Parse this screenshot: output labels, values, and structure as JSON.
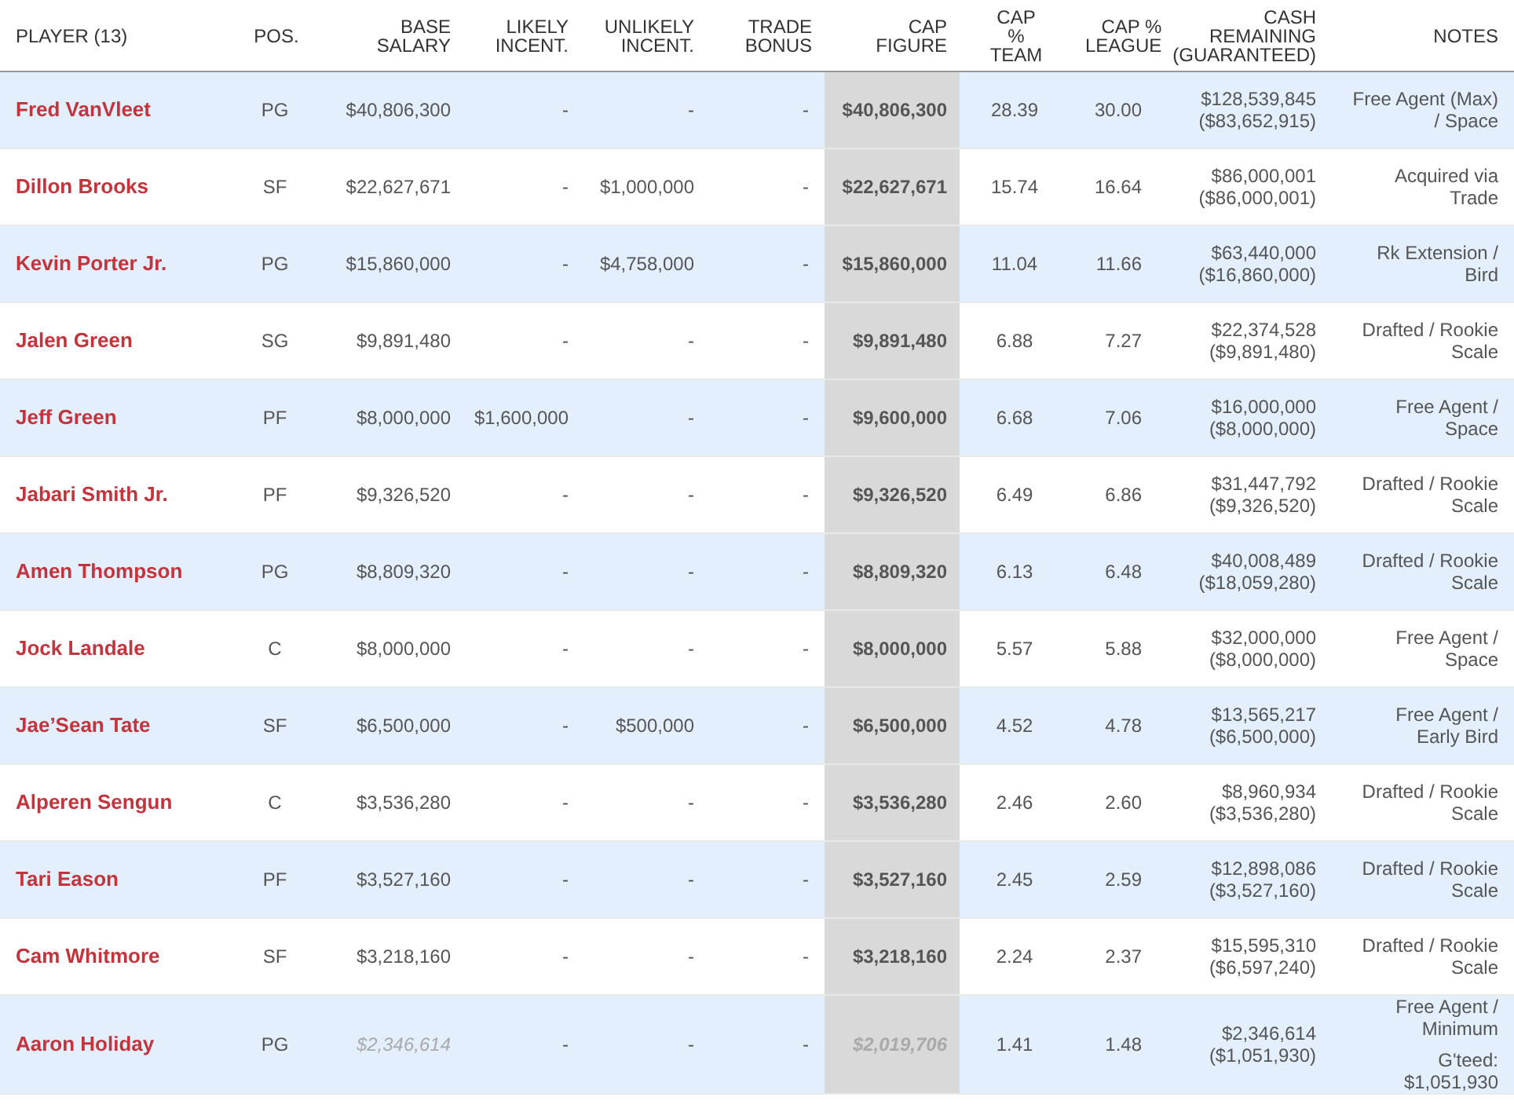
{
  "table": {
    "columns": [
      "PLAYER (13)",
      "POS.",
      "BASE\nSALARY",
      "LIKELY\nINCENT.",
      "UNLIKELY\nINCENT.",
      "TRADE\nBONUS",
      "CAP\nFIGURE",
      "CAP\n%\nTEAM",
      "CAP %\nLEAGUE",
      "CASH\nREMAINING\n(GUARANTEED)",
      "NOTES"
    ],
    "rows": [
      {
        "player": "Fred VanVleet",
        "pos": "PG",
        "base": "$40,806,300",
        "likely": "-",
        "unlikely": "-",
        "trade": "-",
        "cap": "$40,806,300",
        "team_pct": "28.39",
        "league_pct": "30.00",
        "cash": "$128,539,845",
        "guaranteed": "($83,652,915)",
        "notes": [
          "Free Agent (Max) / Space"
        ],
        "non_guaranteed": false
      },
      {
        "player": "Dillon Brooks",
        "pos": "SF",
        "base": "$22,627,671",
        "likely": "-",
        "unlikely": "$1,000,000",
        "trade": "-",
        "cap": "$22,627,671",
        "team_pct": "15.74",
        "league_pct": "16.64",
        "cash": "$86,000,001",
        "guaranteed": "($86,000,001)",
        "notes": [
          "Acquired via Trade"
        ],
        "non_guaranteed": false
      },
      {
        "player": "Kevin Porter Jr.",
        "pos": "PG",
        "base": "$15,860,000",
        "likely": "-",
        "unlikely": "$4,758,000",
        "trade": "-",
        "cap": "$15,860,000",
        "team_pct": "11.04",
        "league_pct": "11.66",
        "cash": "$63,440,000",
        "guaranteed": "($16,860,000)",
        "notes": [
          "Rk Extension / Bird"
        ],
        "non_guaranteed": false
      },
      {
        "player": "Jalen Green",
        "pos": "SG",
        "base": "$9,891,480",
        "likely": "-",
        "unlikely": "-",
        "trade": "-",
        "cap": "$9,891,480",
        "team_pct": "6.88",
        "league_pct": "7.27",
        "cash": "$22,374,528",
        "guaranteed": "($9,891,480)",
        "notes": [
          "Drafted / Rookie Scale"
        ],
        "non_guaranteed": false
      },
      {
        "player": "Jeff Green",
        "pos": "PF",
        "base": "$8,000,000",
        "likely": "$1,600,000",
        "unlikely": "-",
        "trade": "-",
        "cap": "$9,600,000",
        "team_pct": "6.68",
        "league_pct": "7.06",
        "cash": "$16,000,000",
        "guaranteed": "($8,000,000)",
        "notes": [
          "Free Agent / Space"
        ],
        "non_guaranteed": false
      },
      {
        "player": "Jabari Smith Jr.",
        "pos": "PF",
        "base": "$9,326,520",
        "likely": "-",
        "unlikely": "-",
        "trade": "-",
        "cap": "$9,326,520",
        "team_pct": "6.49",
        "league_pct": "6.86",
        "cash": "$31,447,792",
        "guaranteed": "($9,326,520)",
        "notes": [
          "Drafted / Rookie Scale"
        ],
        "non_guaranteed": false
      },
      {
        "player": "Amen Thompson",
        "pos": "PG",
        "base": "$8,809,320",
        "likely": "-",
        "unlikely": "-",
        "trade": "-",
        "cap": "$8,809,320",
        "team_pct": "6.13",
        "league_pct": "6.48",
        "cash": "$40,008,489",
        "guaranteed": "($18,059,280)",
        "notes": [
          "Drafted / Rookie Scale"
        ],
        "non_guaranteed": false
      },
      {
        "player": "Jock Landale",
        "pos": "C",
        "base": "$8,000,000",
        "likely": "-",
        "unlikely": "-",
        "trade": "-",
        "cap": "$8,000,000",
        "team_pct": "5.57",
        "league_pct": "5.88",
        "cash": "$32,000,000",
        "guaranteed": "($8,000,000)",
        "notes": [
          "Free Agent / Space"
        ],
        "non_guaranteed": false
      },
      {
        "player": "Jae’Sean Tate",
        "pos": "SF",
        "base": "$6,500,000",
        "likely": "-",
        "unlikely": "$500,000",
        "trade": "-",
        "cap": "$6,500,000",
        "team_pct": "4.52",
        "league_pct": "4.78",
        "cash": "$13,565,217",
        "guaranteed": "($6,500,000)",
        "notes": [
          "Free Agent / Early Bird"
        ],
        "non_guaranteed": false
      },
      {
        "player": "Alperen Sengun",
        "pos": "C",
        "base": "$3,536,280",
        "likely": "-",
        "unlikely": "-",
        "trade": "-",
        "cap": "$3,536,280",
        "team_pct": "2.46",
        "league_pct": "2.60",
        "cash": "$8,960,934",
        "guaranteed": "($3,536,280)",
        "notes": [
          "Drafted / Rookie Scale"
        ],
        "non_guaranteed": false
      },
      {
        "player": "Tari Eason",
        "pos": "PF",
        "base": "$3,527,160",
        "likely": "-",
        "unlikely": "-",
        "trade": "-",
        "cap": "$3,527,160",
        "team_pct": "2.45",
        "league_pct": "2.59",
        "cash": "$12,898,086",
        "guaranteed": "($3,527,160)",
        "notes": [
          "Drafted / Rookie Scale"
        ],
        "non_guaranteed": false
      },
      {
        "player": "Cam Whitmore",
        "pos": "SF",
        "base": "$3,218,160",
        "likely": "-",
        "unlikely": "-",
        "trade": "-",
        "cap": "$3,218,160",
        "team_pct": "2.24",
        "league_pct": "2.37",
        "cash": "$15,595,310",
        "guaranteed": "($6,597,240)",
        "notes": [
          "Drafted / Rookie Scale"
        ],
        "non_guaranteed": false
      },
      {
        "player": "Aaron Holiday",
        "pos": "PG",
        "base": "$2,346,614",
        "likely": "-",
        "unlikely": "-",
        "trade": "-",
        "cap": "$2,019,706",
        "team_pct": "1.41",
        "league_pct": "1.48",
        "cash": "$2,346,614",
        "guaranteed": "($1,051,930)",
        "notes": [
          "Free Agent / Minimum",
          "G'teed: $1,051,930"
        ],
        "non_guaranteed": true
      }
    ]
  }
}
